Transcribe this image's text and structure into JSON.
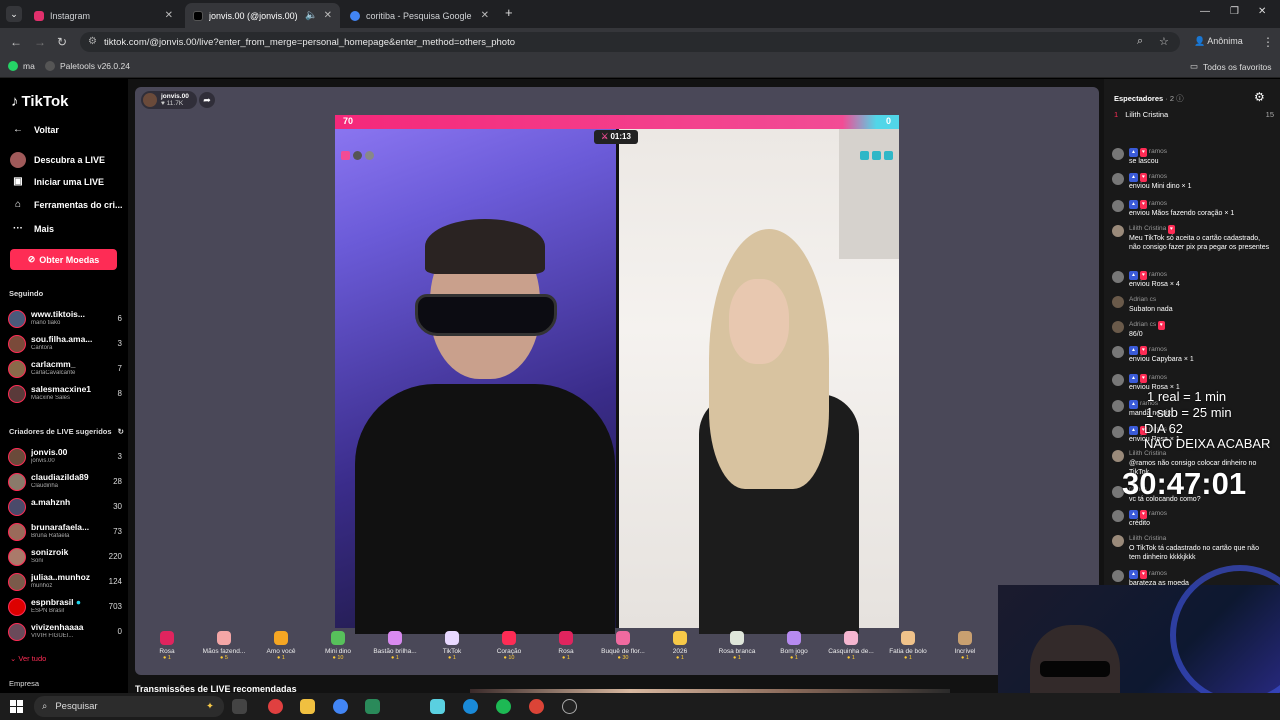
{
  "browser": {
    "tabs": [
      {
        "title": "Instagram",
        "favicon_color": "#e1306c"
      },
      {
        "title": "jonvis.00 (@jonvis.00) com",
        "favicon_color": "#000000"
      },
      {
        "title": "coritiba - Pesquisa Google",
        "favicon_color": "#4285f4"
      }
    ],
    "url": "tiktok.com/@jonvis.00/live?enter_from_merge=personal_homepage&enter_method=others_photo",
    "profile_label": "Anônima",
    "bookmarks": [
      {
        "label": "ma",
        "color": "#25d366"
      },
      {
        "label": "Paletools v26.0.24",
        "color": "#555555"
      }
    ],
    "all_bookmarks": "Todos os favoritos"
  },
  "sidebar": {
    "logo": "TikTok",
    "back": "Voltar",
    "nav": [
      "Descubra a LIVE",
      "Iniciar uma LIVE",
      "Ferramentas do cri...",
      "Mais"
    ],
    "coins_button": "Obter Moedas",
    "following_title": "Seguindo",
    "following": [
      {
        "name": "www.tiktois...",
        "sub": "mano tiako",
        "count": "6"
      },
      {
        "name": "sou.filha.ama...",
        "sub": "Cantora",
        "count": "3"
      },
      {
        "name": "carlacmm_",
        "sub": "CarlaCavalcante",
        "count": "7"
      },
      {
        "name": "salesmacxine1",
        "sub": "Macxine Sales",
        "count": "8"
      }
    ],
    "suggested_title": "Criadores de LIVE sugeridos",
    "suggested": [
      {
        "name": "jonvis.00",
        "sub": "jonvis.00",
        "count": "3"
      },
      {
        "name": "claudiazilda89",
        "sub": "Claudinha",
        "count": "28"
      },
      {
        "name": "a.mahznh",
        "sub": "",
        "count": "30"
      },
      {
        "name": "brunarafaela...",
        "sub": "Bruna Rafaela",
        "count": "73"
      },
      {
        "name": "sonizroik",
        "sub": "Soni",
        "count": "220"
      },
      {
        "name": "juliaa..munhoz",
        "sub": "munhoz",
        "count": "124"
      },
      {
        "name": "espnbrasil",
        "sub": "ESPN Brasil",
        "count": "703"
      },
      {
        "name": "vivizenhaaaa",
        "sub": "VIVIH FIGUEI...",
        "count": "0"
      }
    ],
    "see_all": "Ver tudo",
    "company": "Empresa"
  },
  "stream": {
    "host_name": "jonvis.00",
    "host_likes": "11.7K",
    "score_left": "70",
    "score_right": "0",
    "timer": "01:13",
    "recommended": "Transmissões de LIVE recomendadas",
    "gifts": [
      {
        "name": "Rosa",
        "price": "1",
        "color": "#e0245e"
      },
      {
        "name": "Mãos fazend...",
        "price": "5",
        "color": "#f4a6a6"
      },
      {
        "name": "Amo você",
        "price": "1",
        "color": "#f5a623"
      },
      {
        "name": "Mini dino",
        "price": "10",
        "color": "#57c15b"
      },
      {
        "name": "Bastão brilha...",
        "price": "1",
        "color": "#d88af0"
      },
      {
        "name": "TikTok",
        "price": "1",
        "color": "#e8d8ff"
      },
      {
        "name": "Coração",
        "price": "10",
        "color": "#fe2c55"
      },
      {
        "name": "Rosa",
        "price": "1",
        "color": "#e0245e"
      },
      {
        "name": "Buquê de flor...",
        "price": "30",
        "color": "#f06aa0"
      },
      {
        "name": "2026",
        "price": "1",
        "color": "#f7c948"
      },
      {
        "name": "Rosa branca",
        "price": "1",
        "color": "#dfe6da"
      },
      {
        "name": "Bom jogo",
        "price": "1",
        "color": "#b68af0"
      },
      {
        "name": "Casquinha de...",
        "price": "1",
        "color": "#f5b6d0"
      },
      {
        "name": "Fatia de bolo",
        "price": "1",
        "color": "#f0c28a"
      },
      {
        "name": "Incrível",
        "price": "1",
        "color": "#c9a070"
      }
    ]
  },
  "chat": {
    "viewers_label": "Espectadores",
    "viewers_count": "· 2",
    "top_viewer": {
      "rank": "1",
      "name": "Lilith Cristina",
      "score": "15"
    },
    "messages": [
      {
        "user": "ramos",
        "text": "se lascou"
      },
      {
        "user": "ramos",
        "text": "enviou Mini dino × 1"
      },
      {
        "user": "ramos",
        "text": "enviou Mãos fazendo coração × 1"
      },
      {
        "user": "Lilith Cristina",
        "text": "Meu TikTok só aceita o cartão cadastrado, não consigo fazer pix pra pegar os presentes"
      },
      {
        "user": "ramos",
        "text": "enviou Rosa × 4"
      },
      {
        "user": "Adrian cs",
        "text": "Subaton nada"
      },
      {
        "user": "Adrian cs",
        "text": "86/0"
      },
      {
        "user": "ramos",
        "text": "enviou Capybara × 1"
      },
      {
        "user": "ramos",
        "text": "enviou Rosa × 1"
      },
      {
        "user": "ramos",
        "text": "manda no pix"
      },
      {
        "user": "ramos",
        "text": "enviou Rosa × 1"
      },
      {
        "user": "Lilith Cristina",
        "text": "@ramos não consigo colocar dinheiro no TikTok"
      },
      {
        "user": "ramos",
        "text": "vc tá colocando como?"
      },
      {
        "user": "ramos",
        "text": "crédito"
      },
      {
        "user": "Lilith Cristina",
        "text": "O TikTok tá cadastrado no cartão que não tem dinheiro kkkkjkkk"
      },
      {
        "user": "ramos",
        "text": "barateza as moeda"
      }
    ]
  },
  "overlay": {
    "line1": "1 real = 1 min",
    "line2": "1 sub = 25 min",
    "line3": "DIA 62",
    "line4": "NAO DEIXA ACABAR",
    "countdown": "30:47:01"
  },
  "taskbar": {
    "search_placeholder": "Pesquisar"
  }
}
